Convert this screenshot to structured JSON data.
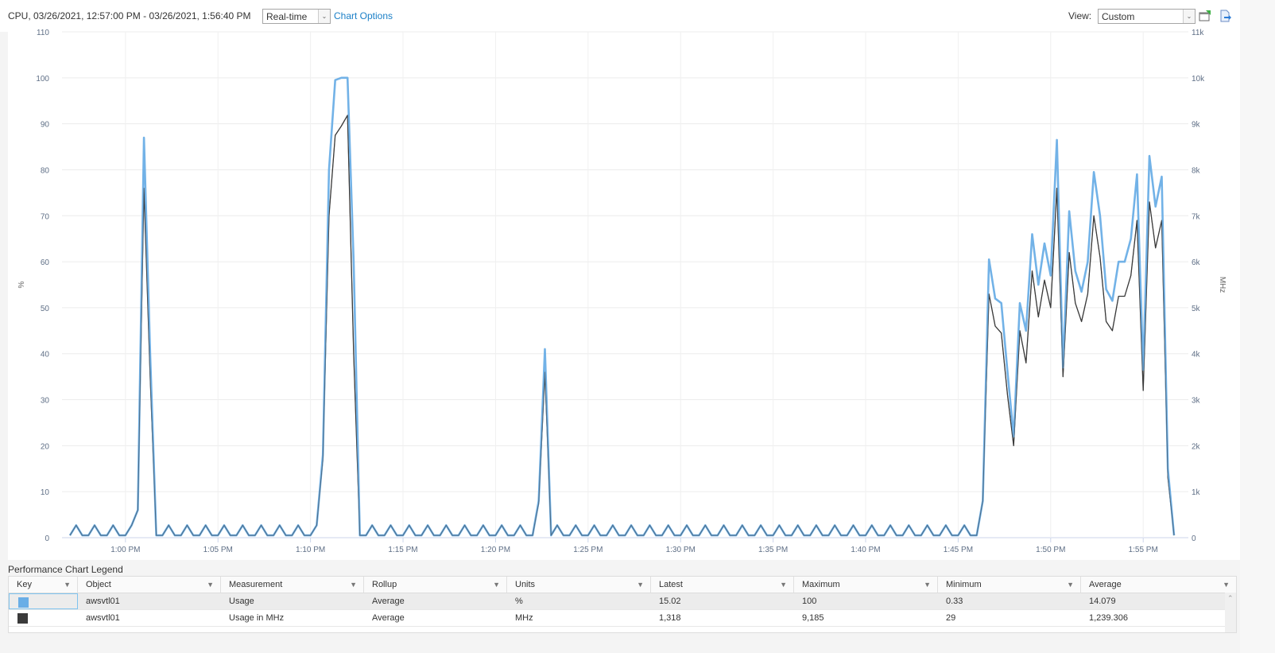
{
  "header": {
    "title": "CPU, 03/26/2021, 12:57:00 PM - 03/26/2021, 1:56:40 PM",
    "period_select": "Real-time",
    "chart_options_link": "Chart Options",
    "view_label": "View:",
    "view_select": "Custom",
    "icons": [
      "new-window-icon",
      "export-icon"
    ]
  },
  "legend": {
    "title": "Performance Chart Legend",
    "columns": [
      "Key",
      "Object",
      "Measurement",
      "Rollup",
      "Units",
      "Latest",
      "Maximum",
      "Minimum",
      "Average"
    ],
    "rows": [
      {
        "key_color": "#6aaee6",
        "object": "awsvtl01",
        "measurement": "Usage",
        "rollup": "Average",
        "units": "%",
        "latest": "15.02",
        "maximum": "100",
        "minimum": "0.33",
        "average": "14.079"
      },
      {
        "key_color": "#3a3a3a",
        "object": "awsvtl01",
        "measurement": "Usage in MHz",
        "rollup": "Average",
        "units": "MHz",
        "latest": "1,318",
        "maximum": "9,185",
        "minimum": "29",
        "average": "1,239.306"
      }
    ]
  },
  "chart_data": {
    "type": "line",
    "title": "CPU",
    "xlabel": "",
    "ylabel": "%",
    "y2label": "MHz",
    "ylim": [
      0,
      110
    ],
    "y2lim": [
      0,
      11000
    ],
    "yticks": [
      "0",
      "10",
      "20",
      "30",
      "40",
      "50",
      "60",
      "70",
      "80",
      "90",
      "100",
      "110"
    ],
    "y2ticks": [
      "0",
      "1k",
      "2k",
      "3k",
      "4k",
      "5k",
      "6k",
      "7k",
      "8k",
      "9k",
      "10k",
      "11k"
    ],
    "xticks": [
      "1:00 PM",
      "1:05 PM",
      "1:10 PM",
      "1:15 PM",
      "1:20 PM",
      "1:25 PM",
      "1:30 PM",
      "1:35 PM",
      "1:40 PM",
      "1:45 PM",
      "1:50 PM",
      "1:55 PM"
    ],
    "x_start": "12:57:00 PM",
    "x_end": "1:56:40 PM",
    "sample_interval_seconds": 20,
    "grid": true,
    "legend_position": "bottom-table",
    "series": [
      {
        "name": "Usage (%)",
        "axis": "left",
        "color": "#6aaee6",
        "spikes": [
          [
            11,
            6
          ],
          [
            12,
            87
          ],
          [
            13,
            40
          ],
          [
            14,
            0.5
          ],
          [
            41,
            18
          ],
          [
            42,
            80
          ],
          [
            43,
            99.5
          ],
          [
            44,
            100
          ],
          [
            45,
            100
          ],
          [
            46,
            60
          ],
          [
            47,
            0.5
          ],
          [
            76,
            8
          ],
          [
            77,
            41
          ],
          [
            78,
            0.5
          ],
          [
            148,
            8
          ],
          [
            149,
            60.5
          ],
          [
            150,
            52
          ],
          [
            151,
            51
          ],
          [
            152,
            36
          ],
          [
            153,
            22
          ],
          [
            154,
            51
          ],
          [
            155,
            45
          ],
          [
            156,
            66
          ],
          [
            157,
            55
          ],
          [
            158,
            64
          ],
          [
            159,
            57
          ],
          [
            160,
            86.5
          ],
          [
            161,
            37
          ],
          [
            162,
            71
          ],
          [
            163,
            58
          ],
          [
            164,
            53.5
          ],
          [
            165,
            60
          ],
          [
            166,
            79.5
          ],
          [
            167,
            70
          ],
          [
            168,
            54
          ],
          [
            169,
            51.5
          ],
          [
            170,
            60
          ],
          [
            171,
            60
          ],
          [
            172,
            65
          ],
          [
            173,
            79
          ],
          [
            174,
            36.5
          ],
          [
            175,
            83
          ],
          [
            176,
            72
          ],
          [
            177,
            78.5
          ],
          [
            178,
            15
          ]
        ]
      },
      {
        "name": "Usage in MHz",
        "axis": "right",
        "color": "#3a3a3a",
        "spikes": [
          [
            11,
            600
          ],
          [
            12,
            7600
          ],
          [
            13,
            3500
          ],
          [
            14,
            50
          ],
          [
            41,
            1700
          ],
          [
            42,
            7000
          ],
          [
            43,
            8750
          ],
          [
            44,
            8950
          ],
          [
            45,
            9185
          ],
          [
            46,
            4000
          ],
          [
            47,
            50
          ],
          [
            76,
            750
          ],
          [
            77,
            3600
          ],
          [
            78,
            50
          ],
          [
            148,
            800
          ],
          [
            149,
            5300
          ],
          [
            150,
            4600
          ],
          [
            151,
            4450
          ],
          [
            152,
            3100
          ],
          [
            153,
            2000
          ],
          [
            154,
            4500
          ],
          [
            155,
            3800
          ],
          [
            156,
            5800
          ],
          [
            157,
            4800
          ],
          [
            158,
            5600
          ],
          [
            159,
            5000
          ],
          [
            160,
            7600
          ],
          [
            161,
            3500
          ],
          [
            162,
            6200
          ],
          [
            163,
            5100
          ],
          [
            164,
            4700
          ],
          [
            165,
            5300
          ],
          [
            166,
            7000
          ],
          [
            167,
            6100
          ],
          [
            168,
            4700
          ],
          [
            169,
            4500
          ],
          [
            170,
            5250
          ],
          [
            171,
            5250
          ],
          [
            172,
            5700
          ],
          [
            173,
            6900
          ],
          [
            174,
            3200
          ],
          [
            175,
            7300
          ],
          [
            176,
            6300
          ],
          [
            177,
            6900
          ],
          [
            178,
            1318
          ]
        ]
      }
    ],
    "baseline": {
      "low_percent": 0.5,
      "high_percent": 2.7,
      "low_mhz": 50,
      "high_mhz": 270,
      "pattern": "alternating"
    },
    "num_points": 180
  }
}
